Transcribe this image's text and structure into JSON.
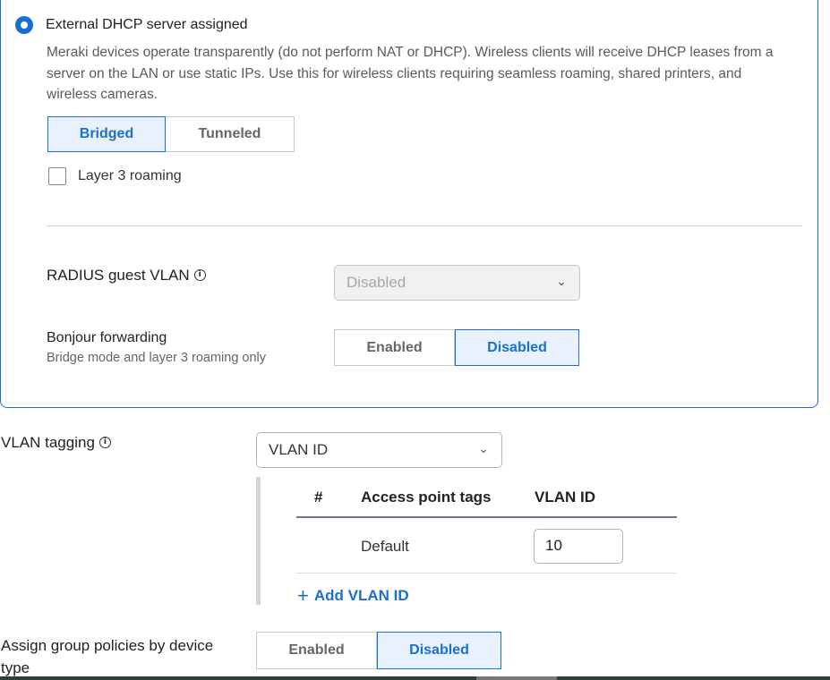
{
  "dhcp_option": {
    "label": "External DHCP server assigned",
    "description": "Meraki devices operate transparently (do not perform NAT or DHCP). Wireless clients will receive DHCP leases from a server on the LAN or use static IPs. Use this for wireless clients requiring seamless roaming, shared printers, and wireless cameras.",
    "mode_options": [
      "Bridged",
      "Tunneled"
    ],
    "mode_selected": "Bridged",
    "layer3_roaming_label": "Layer 3 roaming",
    "layer3_roaming_checked": false
  },
  "radius_guest_vlan": {
    "label": "RADIUS guest VLAN",
    "value": "Disabled",
    "disabled": true
  },
  "bonjour_forwarding": {
    "label": "Bonjour forwarding",
    "sublabel": "Bridge mode and layer 3 roaming only",
    "options": [
      "Enabled",
      "Disabled"
    ],
    "selected": "Disabled"
  },
  "vlan_tagging": {
    "label": "VLAN tagging",
    "select_value": "VLAN ID",
    "table": {
      "headers": [
        "#",
        "Access point tags",
        "VLAN ID"
      ],
      "rows": [
        {
          "number": "",
          "tags": "Default",
          "vlan_id": "10"
        }
      ]
    },
    "add_label": "Add VLAN ID"
  },
  "group_policies": {
    "label": "Assign group policies by device type",
    "options": [
      "Enabled",
      "Disabled"
    ],
    "selected": "Disabled"
  },
  "colors": {
    "accent": "#1a6fd1",
    "active_bg": "#e8f1fc",
    "border": "#c8c8c8"
  }
}
